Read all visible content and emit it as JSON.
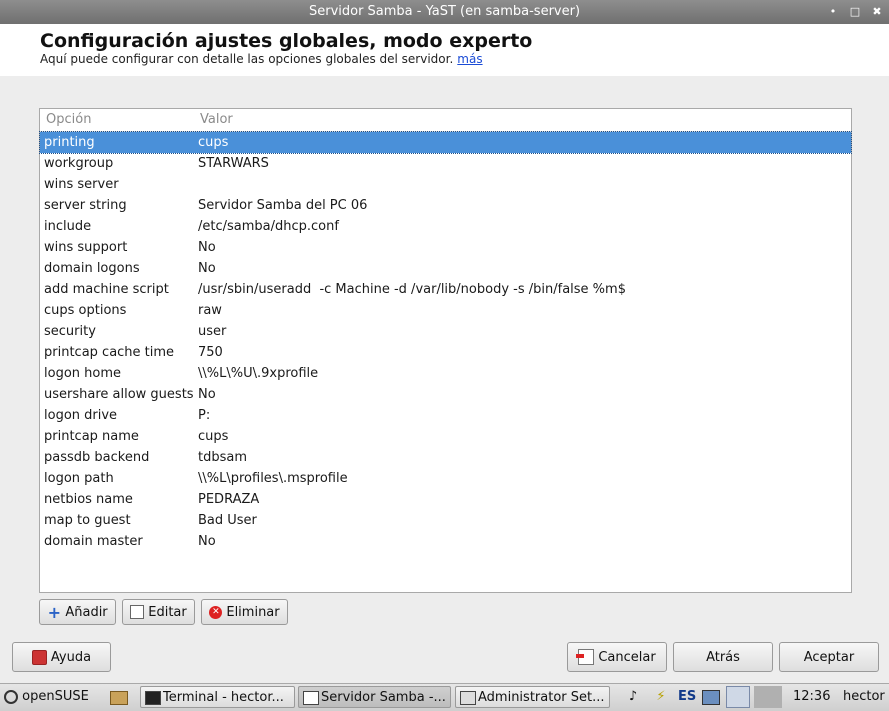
{
  "window": {
    "title": "Servidor Samba - YaST (en samba-server)",
    "controls": [
      "•",
      "□",
      "✖"
    ]
  },
  "header": {
    "title": "Configuración ajustes globales, modo experto",
    "subtitle": "Aquí puede configurar con detalle las opciones globales del servidor.",
    "more_link": "más"
  },
  "table": {
    "columns": [
      "Opción",
      "Valor"
    ],
    "selected_index": 0,
    "rows": [
      {
        "option": "printing",
        "value": "cups"
      },
      {
        "option": "workgroup",
        "value": "STARWARS"
      },
      {
        "option": "wins server",
        "value": ""
      },
      {
        "option": "server string",
        "value": "Servidor Samba del PC 06"
      },
      {
        "option": "include",
        "value": "/etc/samba/dhcp.conf"
      },
      {
        "option": "wins support",
        "value": "No"
      },
      {
        "option": "domain logons",
        "value": "No"
      },
      {
        "option": "add machine script",
        "value": "/usr/sbin/useradd  -c Machine -d /var/lib/nobody -s /bin/false %m$"
      },
      {
        "option": "cups options",
        "value": "raw"
      },
      {
        "option": "security",
        "value": "user"
      },
      {
        "option": "printcap cache time",
        "value": "750"
      },
      {
        "option": "logon home",
        "value": "\\\\%L\\%U\\.9xprofile"
      },
      {
        "option": "usershare allow guests",
        "value": "No"
      },
      {
        "option": "logon drive",
        "value": "P:"
      },
      {
        "option": "printcap name",
        "value": "cups"
      },
      {
        "option": "passdb backend",
        "value": "tdbsam"
      },
      {
        "option": "logon path",
        "value": "\\\\%L\\profiles\\.msprofile"
      },
      {
        "option": "netbios name",
        "value": "PEDRAZA"
      },
      {
        "option": "map to guest",
        "value": "Bad User"
      },
      {
        "option": "domain master",
        "value": "No"
      }
    ]
  },
  "table_buttons": {
    "add": "Añadir",
    "edit": "Editar",
    "delete": "Eliminar"
  },
  "footer_buttons": {
    "help": "Ayuda",
    "cancel": "Cancelar",
    "back": "Atrás",
    "accept": "Aceptar"
  },
  "taskbar": {
    "start": "openSUSE",
    "tasks": [
      "Terminal - hector...",
      "Servidor Samba -...",
      "Administrator Set..."
    ],
    "keyboard_layout": "ES",
    "clock": "12:36",
    "user": "hector"
  },
  "colors": {
    "selection": "#4a90d9",
    "link": "#1a4bd6",
    "titlebar": "#7a7a7a"
  }
}
